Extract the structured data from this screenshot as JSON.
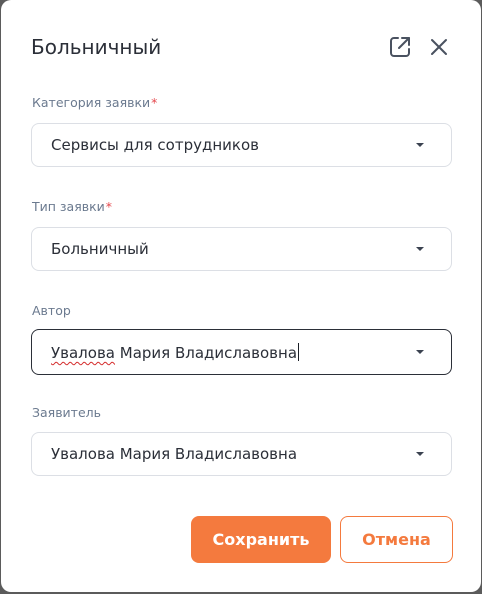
{
  "dialog": {
    "title": "Больничный",
    "open_icon": "external-link-icon",
    "close_icon": "close-icon"
  },
  "fields": {
    "category": {
      "label": "Категория заявки",
      "required_mark": "*",
      "value": "Сервисы для сотрудников"
    },
    "type": {
      "label": "Тип заявки",
      "required_mark": "*",
      "value": "Больничный"
    },
    "author": {
      "label": "Автор",
      "value_first": "Увалова",
      "value_rest": " Мария Владиславовна"
    },
    "applicant": {
      "label": "Заявитель",
      "value": "Увалова Мария Владиславовна"
    }
  },
  "actions": {
    "save_label": "Сохранить",
    "cancel_label": "Отмена"
  },
  "colors": {
    "accent": "#f47a3e",
    "required": "#e5484d",
    "label": "#6b7a8f",
    "text": "#2b2f38"
  }
}
